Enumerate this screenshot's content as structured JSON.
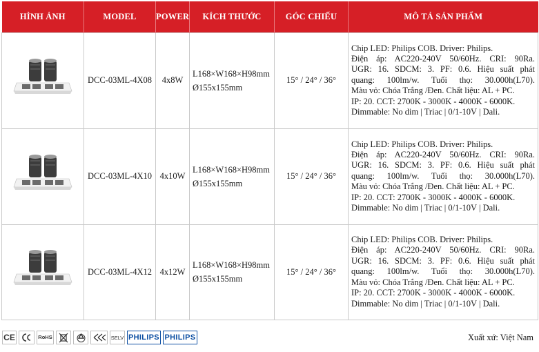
{
  "headers": [
    "HÌNH ẢNH",
    "MODEL",
    "POWER",
    "KÍCH THƯỚC",
    "GÓC CHIẾU",
    "MÔ TẢ SẢN PHẨM"
  ],
  "rows": [
    {
      "model": "DCC-03ML-4X08",
      "power": "4x8W",
      "size_line1": "L168×W168×H98mm",
      "size_line2": "Ø155x155mm",
      "angle": "15° / 24° / 36°",
      "desc": [
        "Chip LED: Philips COB. Driver: Philips.",
        "Điện áp: AC220-240V 50/60Hz. CRI: 90Ra.",
        "UGR: 16. SDCM: 3. PF: 0.6. Hiệu suất phát",
        "quang: 100lm/w. Tuổi thọ: 30.000h(L70).",
        "Màu vỏ: Chóa Trắng /Đen. Chất liệu: AL + PC.",
        "IP: 20. CCT: 2700K - 3000K - 4000K - 6000K.",
        "Dimmable: No dim | Triac | 0/1-10V | Dali."
      ]
    },
    {
      "model": "DCC-03ML-4X10",
      "power": "4x10W",
      "size_line1": "L168×W168×H98mm",
      "size_line2": "Ø155x155mm",
      "angle": "15° / 24° / 36°",
      "desc": [
        "Chip LED: Philips COB. Driver: Philips.",
        "Điện áp: AC220-240V 50/60Hz. CRI: 90Ra.",
        "UGR: 16. SDCM: 3. PF: 0.6. Hiệu suất phát",
        "quang: 100lm/w. Tuổi thọ: 30.000h(L70).",
        "Màu vỏ: Chóa Trắng /Đen. Chất liệu: AL + PC.",
        "IP: 20. CCT: 2700K - 3000K - 4000K - 6000K.",
        "Dimmable: No dim | Triac | 0/1-10V | Dali."
      ]
    },
    {
      "model": "DCC-03ML-4X12",
      "power": "4x12W",
      "size_line1": "L168×W168×H98mm",
      "size_line2": "Ø155x155mm",
      "angle": "15° / 24° / 36°",
      "desc": [
        "Chip LED: Philips COB. Driver: Philips.",
        "Điện áp: AC220-240V 50/60Hz. CRI: 90Ra.",
        "UGR: 16. SDCM: 3. PF: 0.6. Hiệu suất phát",
        "quang: 100lm/w. Tuổi thọ: 30.000h(L70).",
        "Màu vỏ: Chóa Trắng /Đen. Chất liệu: AL + PC.",
        "IP: 20. CCT: 2700K - 3000K - 4000K - 6000K.",
        "Dimmable: No dim | Triac | 0/1-10V | Dali."
      ]
    }
  ],
  "certifications": {
    "ce": "CE",
    "rohs": "RoHS",
    "selv": "SELV",
    "philips_1": "PHILIPS",
    "philips_2": "PHILIPS"
  },
  "origin": "Xuất xứ: Việt Nam",
  "colors": {
    "header_bg": "#d61f26",
    "brand_blue": "#0b4ea2"
  }
}
